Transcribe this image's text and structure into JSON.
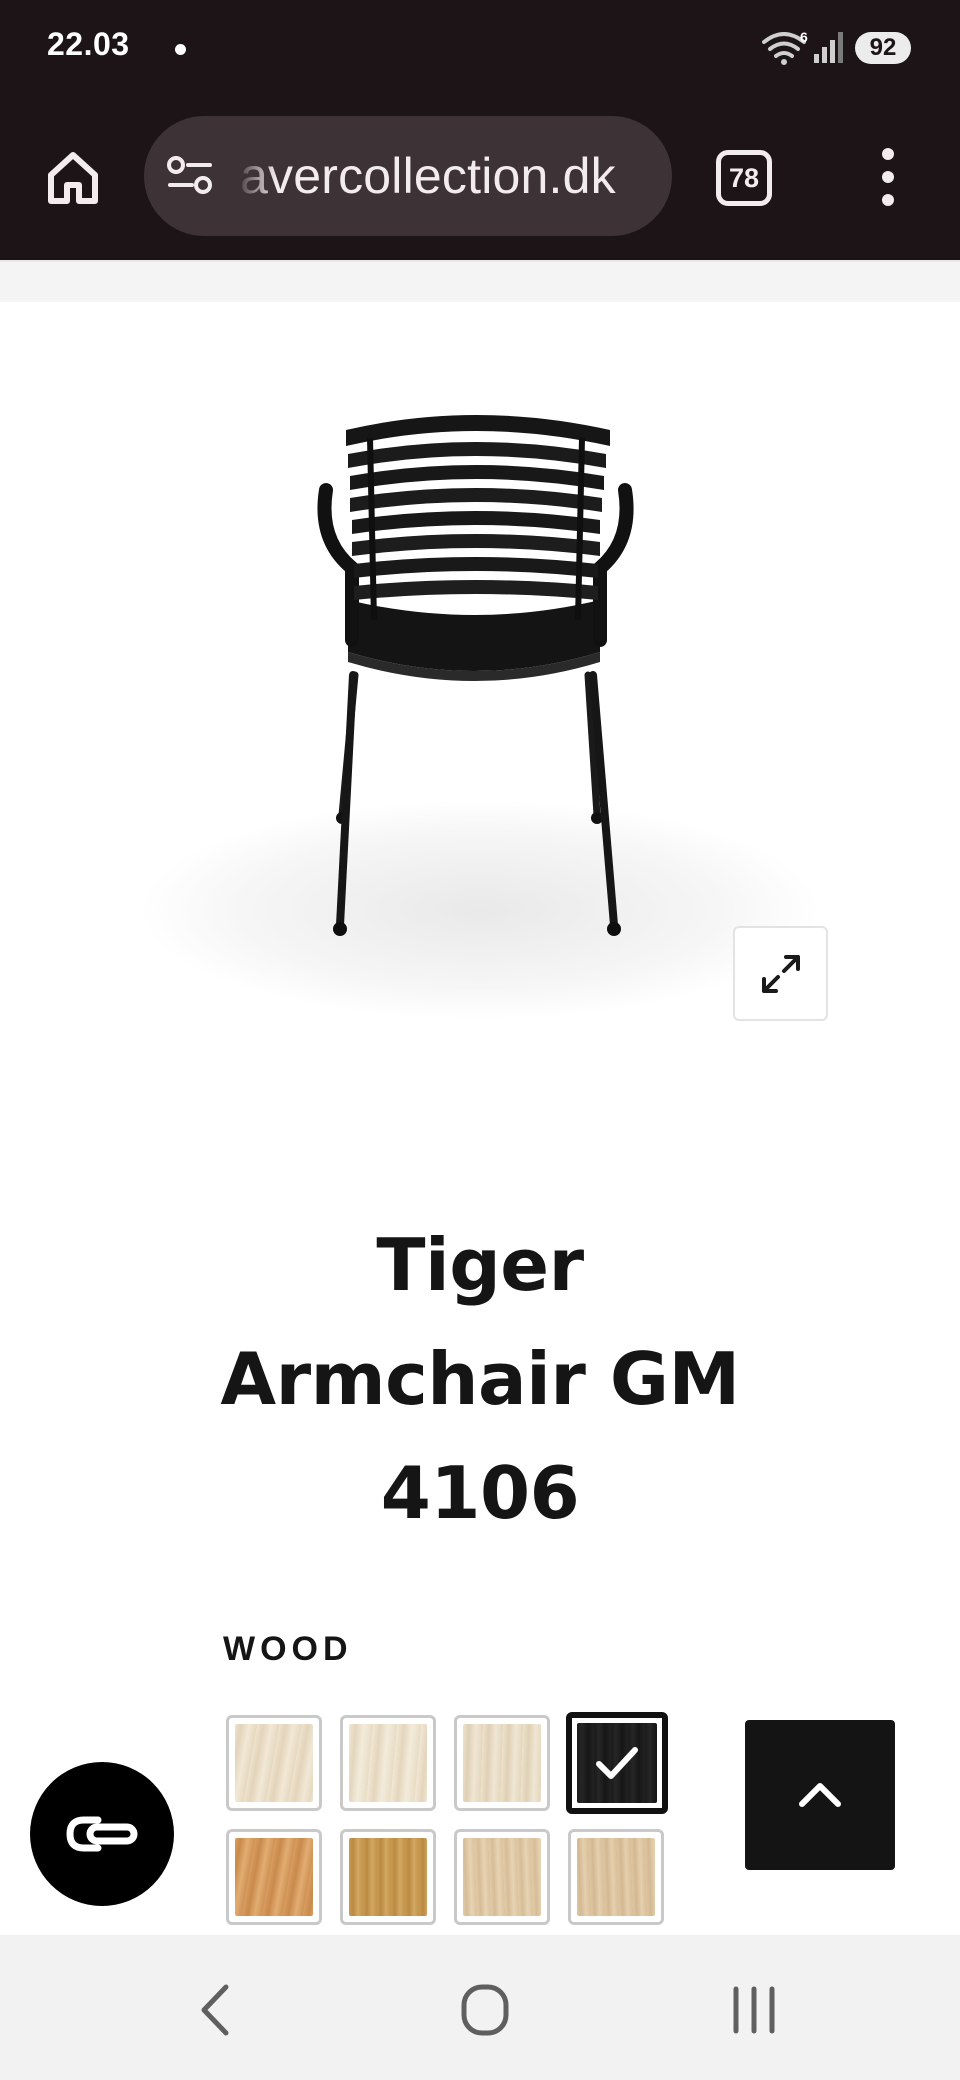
{
  "status_bar": {
    "time": "22.03",
    "network_badge": "6",
    "battery": "92"
  },
  "browser": {
    "url": "avercollection.dk",
    "tab_count": "78",
    "icons": [
      "home-icon",
      "tune-icon",
      "tabs-icon",
      "more-vert-icon"
    ]
  },
  "product": {
    "title_line1": "Tiger",
    "title_line2": "Armchair GM",
    "title_line3": "4106",
    "image_subject": "black slatted armchair, rear view",
    "expand_icon": "expand-arrows-icon"
  },
  "options": {
    "wood_label": "WOOD",
    "swatches": [
      {
        "name": "light-wood-1",
        "color": "#e9dcc6",
        "selected": false
      },
      {
        "name": "light-wood-2",
        "color": "#ebe0cb",
        "selected": false
      },
      {
        "name": "light-wood-3",
        "color": "#e6dac2",
        "selected": false
      },
      {
        "name": "black-wood",
        "color": "#1b1b1b",
        "selected": true
      },
      {
        "name": "teak",
        "color": "#d49a5e",
        "selected": false
      },
      {
        "name": "oak",
        "color": "#c79a52",
        "selected": false
      },
      {
        "name": "light-oak-1",
        "color": "#dfc7a3",
        "selected": false
      },
      {
        "name": "light-oak-2",
        "color": "#dcc4a0",
        "selected": false
      }
    ]
  },
  "floating": {
    "scroll_top_icon": "chevron-up-icon",
    "chat_icon": "chat-link-icon"
  },
  "system_nav": {
    "back_icon": "back-chevron-icon",
    "home_icon": "home-circle-icon",
    "recents_icon": "recents-icon"
  },
  "colors": {
    "chrome_bg": "#1c1416",
    "url_bar_bg": "#3d3235",
    "text_dark": "#151515",
    "scroll_btn_bg": "#141414",
    "nav_bar_bg": "#f2f2f2"
  }
}
